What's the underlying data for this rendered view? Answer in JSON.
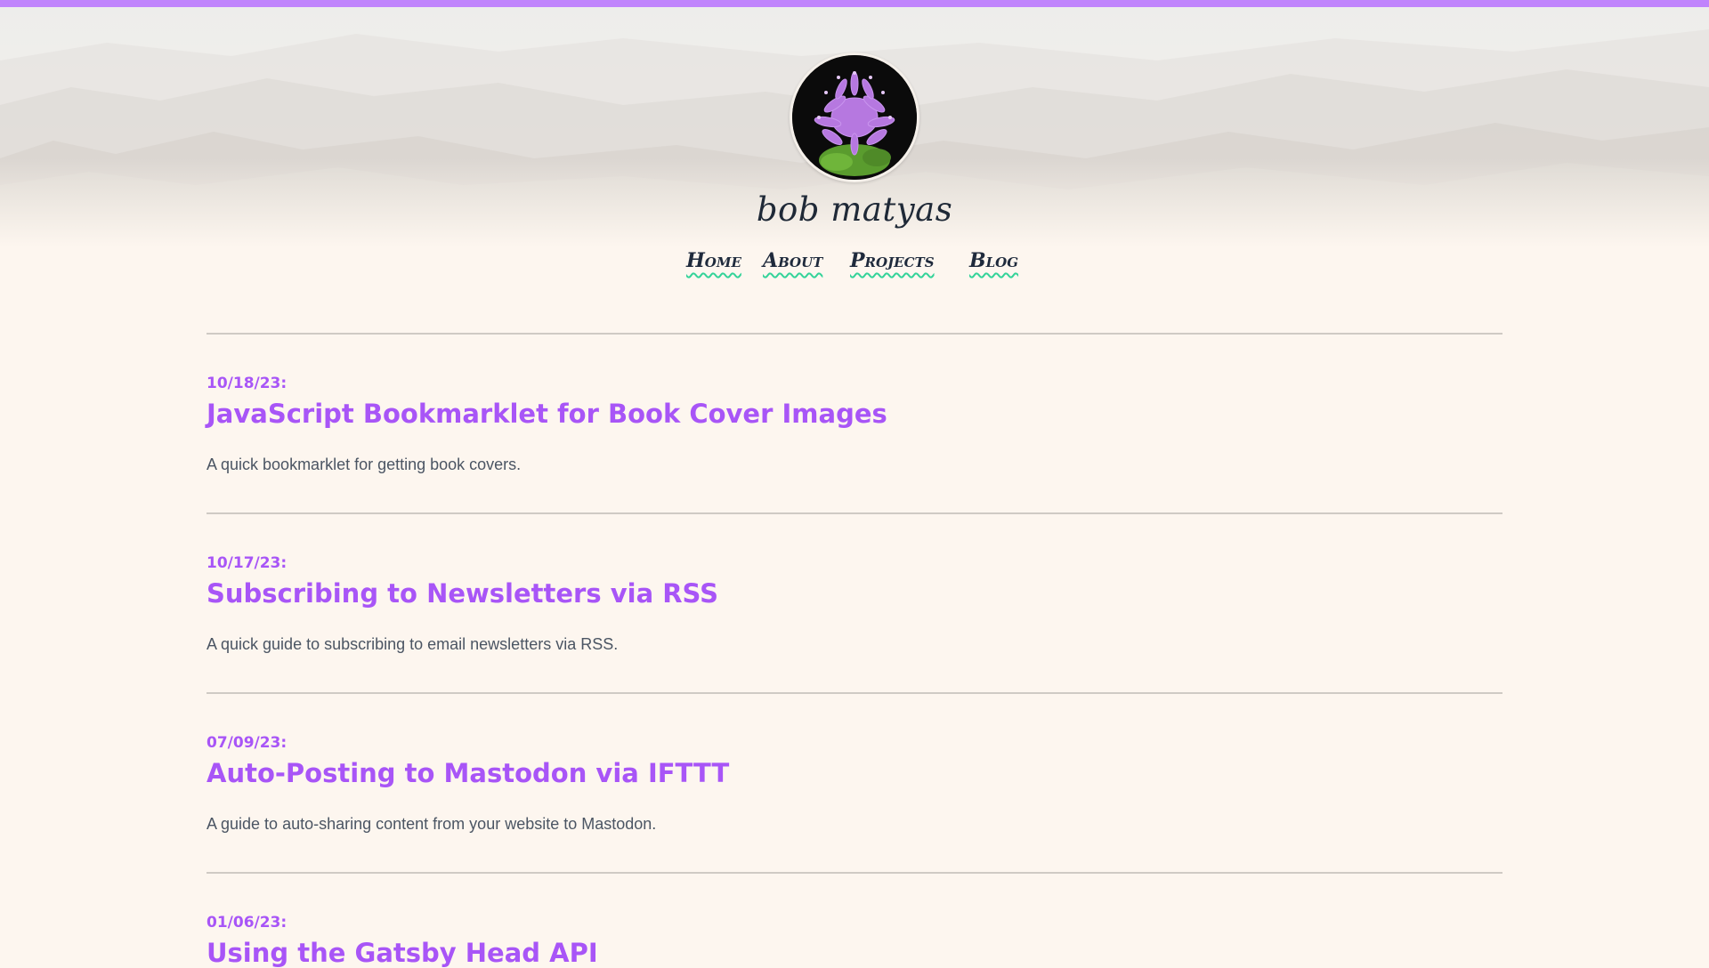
{
  "colors": {
    "accent": "#a855f7",
    "top_bar": "#c084fc",
    "background": "#fdf6ef",
    "nav_underline": "#34d399",
    "text": "#1f2937"
  },
  "header": {
    "avatar_icon": "flower-avatar",
    "site_title": "bob matyas"
  },
  "nav": {
    "items": [
      {
        "label": "Home"
      },
      {
        "label": "About"
      },
      {
        "label": "Projects"
      },
      {
        "label": "Blog"
      }
    ]
  },
  "posts": [
    {
      "date": "10/18/23:",
      "title": "JavaScript Bookmarklet for Book Cover Images",
      "description": "A quick bookmarklet for getting book covers."
    },
    {
      "date": "10/17/23:",
      "title": "Subscribing to Newsletters via RSS",
      "description": "A quick guide to subscribing to email newsletters via RSS."
    },
    {
      "date": "07/09/23:",
      "title": "Auto-Posting to Mastodon via IFTTT",
      "description": "A guide to auto-sharing content from your website to Mastodon."
    },
    {
      "date": "01/06/23:",
      "title": "Using the Gatsby Head API",
      "description": ""
    }
  ]
}
